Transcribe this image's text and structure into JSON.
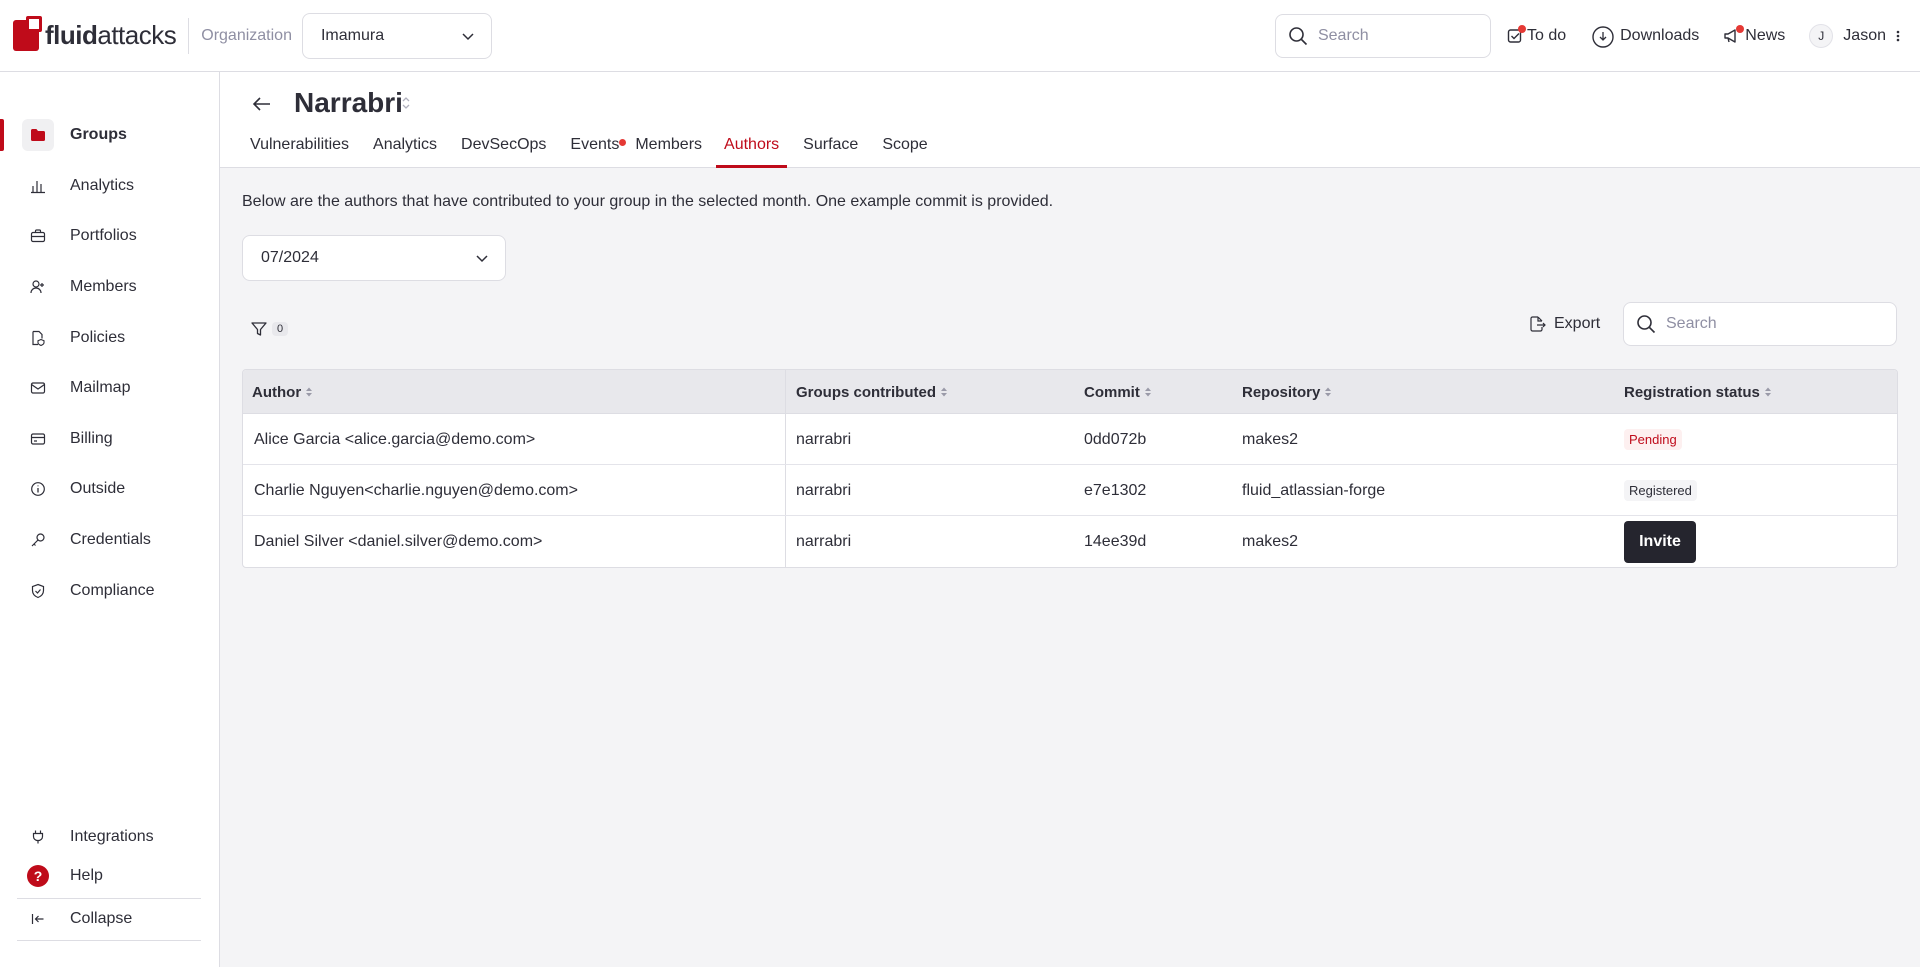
{
  "brand": {
    "name_bold": "fluid",
    "name_rest": "attacks",
    "accent": "#bf0b1a"
  },
  "header": {
    "org_label": "Organization",
    "org_value": "Imamura",
    "search_placeholder": "Search",
    "todo": "To do",
    "downloads": "Downloads",
    "news": "News",
    "user_initial": "J",
    "user_name": "Jason"
  },
  "sidebar": {
    "items": [
      {
        "label": "Groups",
        "icon": "folder-icon"
      },
      {
        "label": "Analytics",
        "icon": "bar-chart-icon"
      },
      {
        "label": "Portfolios",
        "icon": "briefcase-icon"
      },
      {
        "label": "Members",
        "icon": "user-plus-icon"
      },
      {
        "label": "Policies",
        "icon": "policy-icon"
      },
      {
        "label": "Mailmap",
        "icon": "mail-icon"
      },
      {
        "label": "Billing",
        "icon": "credit-card-icon"
      },
      {
        "label": "Outside",
        "icon": "info-icon"
      },
      {
        "label": "Credentials",
        "icon": "key-icon"
      },
      {
        "label": "Compliance",
        "icon": "shield-check-icon"
      }
    ],
    "integrations": "Integrations",
    "help": "Help",
    "help_glyph": "?",
    "collapse": "Collapse"
  },
  "group": {
    "title": "Narrabri",
    "tabs": [
      "Vulnerabilities",
      "Analytics",
      "DevSecOps",
      "Events",
      "Members",
      "Authors",
      "Surface",
      "Scope"
    ],
    "active_tab": "Authors"
  },
  "authors": {
    "description": "Below are the authors that have contributed to your group in the selected month. One example commit is provided.",
    "month": "07/2024",
    "filter_count": "0",
    "export": "Export",
    "search_placeholder": "Search",
    "columns": [
      "Author",
      "Groups contributed",
      "Commit",
      "Repository",
      "Registration status"
    ],
    "rows": [
      {
        "author": "Alice Garcia <alice.garcia@demo.com>",
        "groups": "narrabri",
        "commit": "0dd072b",
        "repository": "makes2",
        "status": "Pending"
      },
      {
        "author": "Charlie Nguyen<charlie.nguyen@demo.com>",
        "groups": "narrabri",
        "commit": "e7e1302",
        "repository": "fluid_atlassian-forge",
        "status": "Registered"
      },
      {
        "author": "Daniel Silver <daniel.silver@demo.com>",
        "groups": "narrabri",
        "commit": "14ee39d",
        "repository": "makes2",
        "status": "Invite"
      }
    ]
  }
}
